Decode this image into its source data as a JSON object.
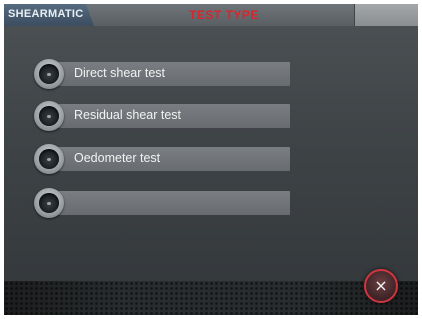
{
  "header": {
    "brand": "SHEARMATIC",
    "title": "TEST TYPE"
  },
  "options": [
    {
      "label": "Direct shear test",
      "icon": "radio-knob-icon"
    },
    {
      "label": "Residual shear test",
      "icon": "radio-knob-icon"
    },
    {
      "label": "Oedometer test",
      "icon": "radio-knob-icon"
    },
    {
      "label": "",
      "icon": "radio-knob-icon"
    }
  ],
  "footer": {
    "close_icon": "×"
  },
  "colors": {
    "title_red": "#d6262f",
    "brand_tab": "#4a5d70",
    "panel": "#3e4346",
    "close_ring": "#d03540"
  }
}
